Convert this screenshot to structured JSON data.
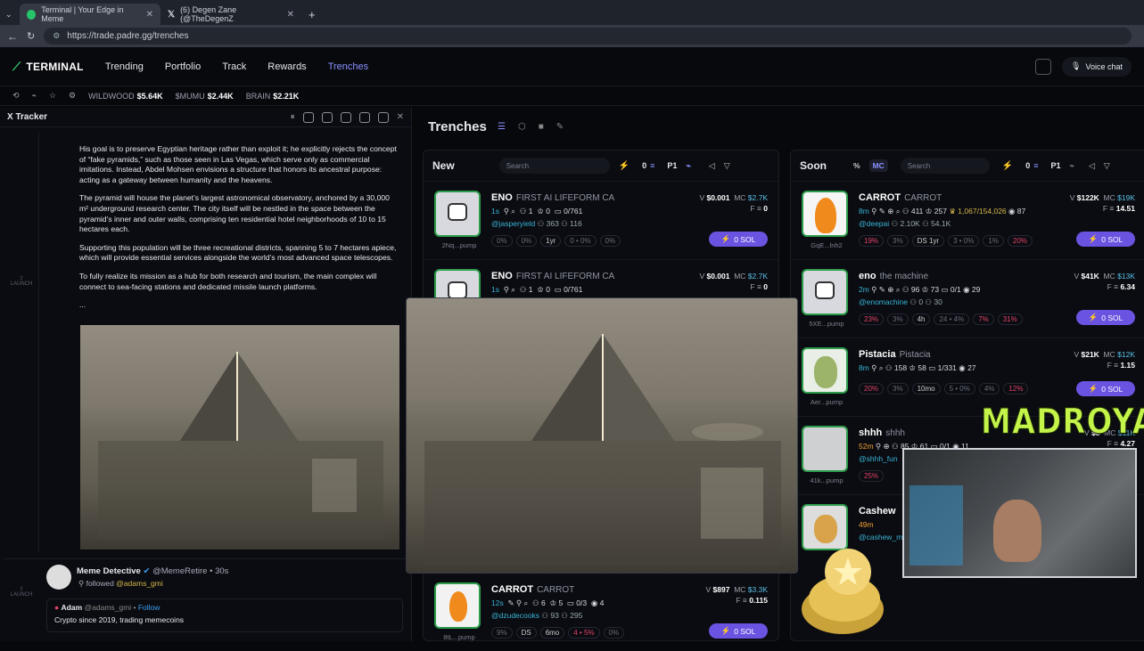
{
  "browser": {
    "tabs": [
      {
        "title": "Terminal | Your Edge in Meme"
      },
      {
        "title": "(6) Degen Zane (@TheDegenZ"
      }
    ],
    "url": "https://trade.padre.gg/trenches"
  },
  "nav": {
    "logo": "TERMINAL",
    "items": [
      "Trending",
      "Portfolio",
      "Track",
      "Rewards",
      "Trenches"
    ],
    "active": "Trenches",
    "voice_chat": "Voice chat"
  },
  "ticker": [
    {
      "name": "WILDWOOD",
      "value": "$5.64K"
    },
    {
      "name": "$MUMU",
      "value": "$2.44K"
    },
    {
      "name": "BRAIN",
      "value": "$2.21K"
    }
  ],
  "tracker": {
    "title": "X Tracker",
    "launch_label": "LAUNCH",
    "paragraphs": [
      "His goal is to preserve Egyptian heritage rather than exploit it; he explicitly rejects the concept of “fake pyramids,” such as those seen in Las Vegas, which serve only as commercial imitations. Instead, Abdel Mohsen envisions a structure that honors its ancestral purpose: acting as a gateway between humanity and the heavens.",
      "The pyramid will house the planet’s largest astronomical observatory, anchored by a 30,000 m² underground research center. The city itself will be nestled in the space between the pyramid’s inner and outer walls, comprising ten residential hotel neighborhoods of 10 to 15 hectares each.",
      "Supporting this population will be three recreational districts, spanning 5 to 7 hectares apiece, which will provide essential services alongside the world’s most advanced space telescopes.",
      "To fully realize its mission as a hub for both research and tourism, the main complex will connect to sea-facing stations and dedicated missile launch platforms.",
      "..."
    ],
    "second_tweet": {
      "author": "Meme Detective",
      "handle": "@MemeRetire",
      "time": "30s",
      "action": "followed",
      "target": "@adams_gmi",
      "quoted_name": "Adam",
      "quoted_handle": "@adams_gmi",
      "follow": "Follow",
      "bio": "Crypto since 2019, trading memecoins"
    }
  },
  "trenches": {
    "title": "Trenches",
    "new_col": {
      "title": "New",
      "search_placeholder": "Search",
      "count": "0",
      "preset": "P1",
      "cards": [
        {
          "name": "ENO",
          "sub": "FIRST AI LIFEFORM CA",
          "age": "1s",
          "holders": "1",
          "x": "0",
          "ratio": "0/761",
          "handle": "@jasperyield",
          "f1": "363",
          "f2": "116",
          "v": "$0.001",
          "mc": "$2.7K",
          "f": "0",
          "addr": "2Nq...pump",
          "pills": [
            "0%",
            "0%",
            "1yr",
            "0 • 0%",
            "0%"
          ],
          "btn": "0 SOL"
        },
        {
          "name": "ENO",
          "sub": "FIRST AI LIFEFORM CA",
          "age": "1s",
          "holders": "1",
          "x": "0",
          "ratio": "0/761",
          "v": "$0.001",
          "mc": "$2.7K",
          "f": "0"
        },
        {
          "name": "CARROT",
          "sub": "CARROT",
          "age": "12s",
          "holders": "6",
          "x": "5",
          "ratio": "0/3",
          "eye": "4",
          "handle": "@dzudecooks",
          "f1": "93",
          "f2": "295",
          "v": "$897",
          "mc": "$3.3K",
          "f": "0.115",
          "addr": "8tL...pump",
          "pills": [
            "9%",
            "DS",
            "6mo",
            "4 • 5%",
            "0%"
          ],
          "btn": "0 SOL"
        }
      ]
    },
    "soon_col": {
      "title": "Soon",
      "toggle": [
        "%",
        "MC"
      ],
      "search_placeholder": "Search",
      "count": "0",
      "preset": "P1",
      "cards": [
        {
          "name": "CARROT",
          "sub": "CARROT",
          "age": "8m",
          "holders": "411",
          "x": "257",
          "ratio": "1,067/154,026",
          "eye": "87",
          "handle": "@deepai",
          "f1": "2.10K",
          "f2": "54.1K",
          "v": "$122K",
          "mc": "$19K",
          "f": "14.51",
          "addr": "GqE...lnh2",
          "pills": [
            "19%",
            "3%",
            "DS",
            "1yr",
            "3 • 0%",
            "1%",
            "20%"
          ],
          "btn": "0 SOL"
        },
        {
          "name": "eno",
          "sub": "the machine",
          "age": "2m",
          "holders": "96",
          "x": "73",
          "ratio": "0/1",
          "eye": "29",
          "handle": "@enomachine",
          "f1": "0",
          "f2": "30",
          "v": "$41K",
          "mc": "$13K",
          "f": "6.34",
          "addr": "5XE...pump",
          "pills": [
            "23%",
            "3%",
            "4h",
            "24 • 4%",
            "7%",
            "31%"
          ],
          "btn": "0 SOL"
        },
        {
          "name": "Pistacia",
          "sub": "Pistacia",
          "age": "8m",
          "holders": "158",
          "x": "58",
          "ratio": "1/331",
          "eye": "27",
          "v": "$21K",
          "mc": "$12K",
          "f": "1.15",
          "addr": "Aer...pump",
          "pills": [
            "20%",
            "3%",
            "10mo",
            "5 • 0%",
            "4%",
            "12%"
          ],
          "btn": "0 SOL"
        },
        {
          "name": "shhh",
          "sub": "shhh",
          "age": "52m",
          "holders": "85",
          "x": "61",
          "ratio": "0/1",
          "eye": "11",
          "handle": "@shhh_fun",
          "v": "$8",
          "mc": "$11K",
          "f": "4.27",
          "addr": "41k...pump",
          "pills": [
            "25%"
          ]
        },
        {
          "name": "Cashew",
          "age": "49m",
          "handle": "@cashew_m"
        }
      ]
    }
  },
  "stream": {
    "overlay_text": "MADROYALS"
  },
  "colors": {
    "accent": "#6a53e0",
    "active_nav": "#8a92ff",
    "positive": "#3fbf6a",
    "negative": "#e0446a",
    "handle": "#37b3d6"
  }
}
